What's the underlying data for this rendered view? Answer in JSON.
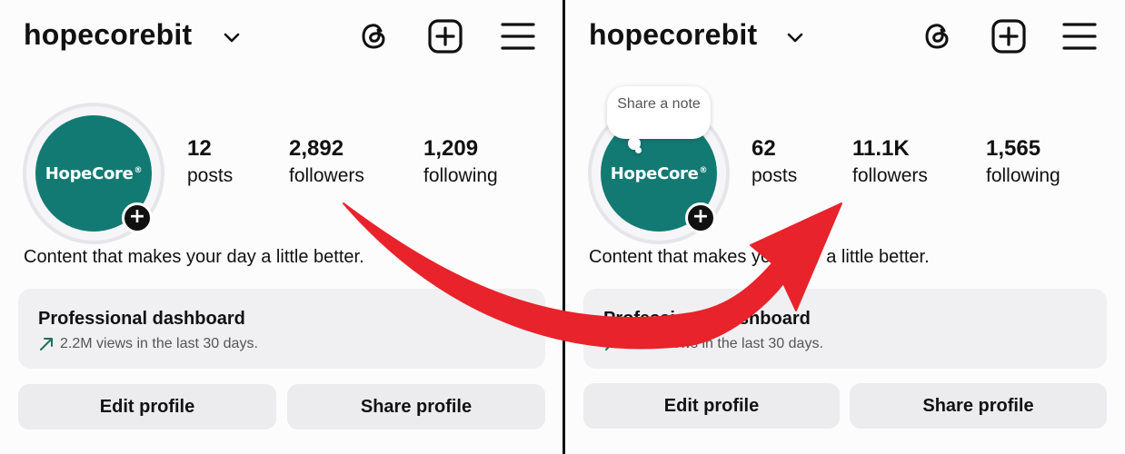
{
  "accent_colors": {
    "avatar_bg": "#127a73",
    "arrow": "#e8232b",
    "badge": "#111111"
  },
  "before": {
    "header": {
      "username": "hopecorebit",
      "icons": [
        "chevron-down-icon",
        "threads-icon",
        "add-post-icon",
        "menu-icon"
      ]
    },
    "avatar": {
      "logo_text": "HopeCore",
      "logo_mark": "®"
    },
    "stats": {
      "posts": {
        "value": "12",
        "label": "posts"
      },
      "followers": {
        "value": "2,892",
        "label": "followers"
      },
      "following": {
        "value": "1,209",
        "label": "following"
      }
    },
    "bio": "Content that makes your day a little better.",
    "dashboard": {
      "title": "Professional dashboard",
      "subtitle": "2.2M views in the last 30 days."
    },
    "buttons": {
      "edit": "Edit profile",
      "share": "Share profile"
    }
  },
  "after": {
    "header": {
      "username": "hopecorebit",
      "icons": [
        "chevron-down-icon",
        "threads-icon",
        "add-post-icon",
        "menu-icon"
      ]
    },
    "note_prompt": "Share a note",
    "avatar": {
      "logo_text": "HopeCore",
      "logo_mark": "®"
    },
    "stats": {
      "posts": {
        "value": "62",
        "label": "posts"
      },
      "followers": {
        "value": "11.1K",
        "label": "followers"
      },
      "following": {
        "value": "1,565",
        "label": "following"
      }
    },
    "bio": "Content that makes your day a little better.",
    "dashboard": {
      "title": "Professional dashboard",
      "subtitle": "8.9M views in the last 30 days."
    },
    "buttons": {
      "edit": "Edit profile",
      "share": "Share profile"
    }
  }
}
